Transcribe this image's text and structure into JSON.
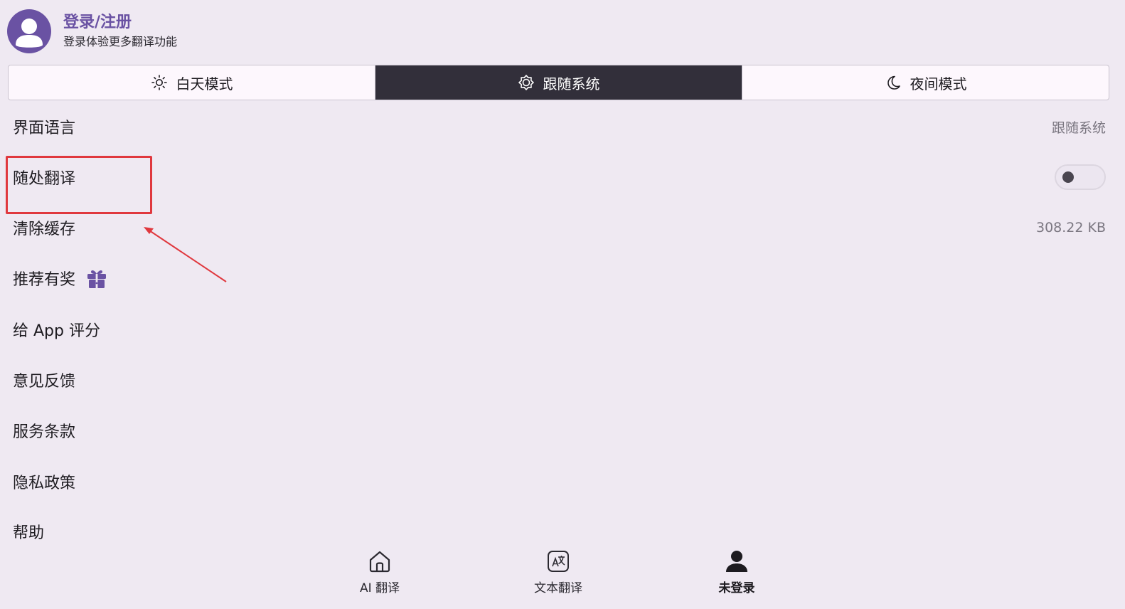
{
  "header": {
    "title": "登录/注册",
    "subtitle": "登录体验更多翻译功能"
  },
  "theme": {
    "selected": "跟随系统",
    "options": [
      {
        "label": "白天模式",
        "icon": "sun-icon"
      },
      {
        "label": "跟随系统",
        "icon": "auto-brightness-icon"
      },
      {
        "label": "夜间模式",
        "icon": "moon-icon"
      }
    ]
  },
  "settings": {
    "language": {
      "label": "界面语言",
      "value": "跟随系统"
    },
    "translate_anywhere": {
      "label": "随处翻译",
      "enabled": false
    },
    "clear_cache": {
      "label": "清除缓存",
      "value": "308.22 KB"
    },
    "referral": {
      "label": "推荐有奖",
      "icon": "gift-icon"
    },
    "rate_app": {
      "label": "给 App 评分"
    },
    "feedback": {
      "label": "意见反馈"
    },
    "terms": {
      "label": "服务条款"
    },
    "privacy": {
      "label": "隐私政策"
    },
    "help": {
      "label": "帮助"
    }
  },
  "nav": {
    "items": [
      {
        "label": "AI 翻译",
        "icon": "home-icon"
      },
      {
        "label": "文本翻译",
        "icon": "translate-icon"
      },
      {
        "label": "未登录",
        "icon": "person-icon",
        "active": true
      }
    ]
  },
  "colors": {
    "background": "#efe9f2",
    "accent": "#6a52a3",
    "active_segment": "#322f3a",
    "annotation": "#e0383e"
  }
}
